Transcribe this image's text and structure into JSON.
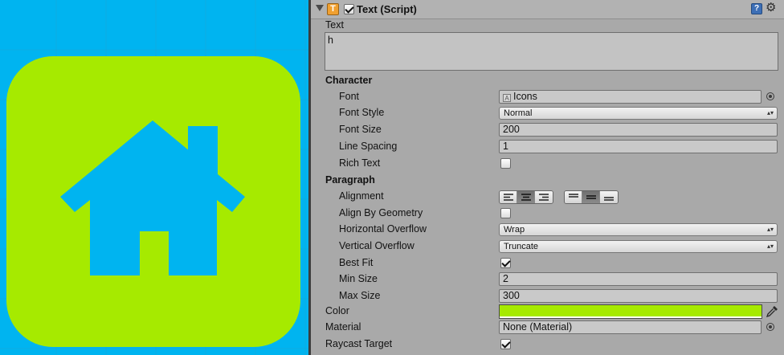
{
  "preview": {
    "background_color": "#00b4f0",
    "tile_color": "#a6ea00",
    "house_color": "#00b4f0",
    "icon": "home-icon"
  },
  "component": {
    "title": "Text (Script)",
    "enabled": true,
    "icons": {
      "type": "text-component-icon",
      "help": "help-book-icon",
      "settings": "gear-icon"
    }
  },
  "text_field": {
    "label": "Text",
    "value": "h"
  },
  "sections": {
    "character": "Character",
    "paragraph": "Paragraph"
  },
  "fields": {
    "font": {
      "label": "Font",
      "value": "Icons"
    },
    "font_style": {
      "label": "Font Style",
      "value": "Normal"
    },
    "font_size": {
      "label": "Font Size",
      "value": "200"
    },
    "line_spacing": {
      "label": "Line Spacing",
      "value": "1"
    },
    "rich_text": {
      "label": "Rich Text",
      "checked": false
    },
    "alignment": {
      "label": "Alignment",
      "horizontal": "center",
      "vertical": "middle"
    },
    "align_by_geometry": {
      "label": "Align By Geometry",
      "checked": false
    },
    "horizontal_overflow": {
      "label": "Horizontal Overflow",
      "value": "Wrap"
    },
    "vertical_overflow": {
      "label": "Vertical Overflow",
      "value": "Truncate"
    },
    "best_fit": {
      "label": "Best Fit",
      "checked": true
    },
    "min_size": {
      "label": "Min Size",
      "value": "2"
    },
    "max_size": {
      "label": "Max Size",
      "value": "300"
    },
    "color": {
      "label": "Color",
      "value": "#a6ea00"
    },
    "material": {
      "label": "Material",
      "value": "None (Material)"
    },
    "raycast_target": {
      "label": "Raycast Target",
      "checked": true
    }
  }
}
